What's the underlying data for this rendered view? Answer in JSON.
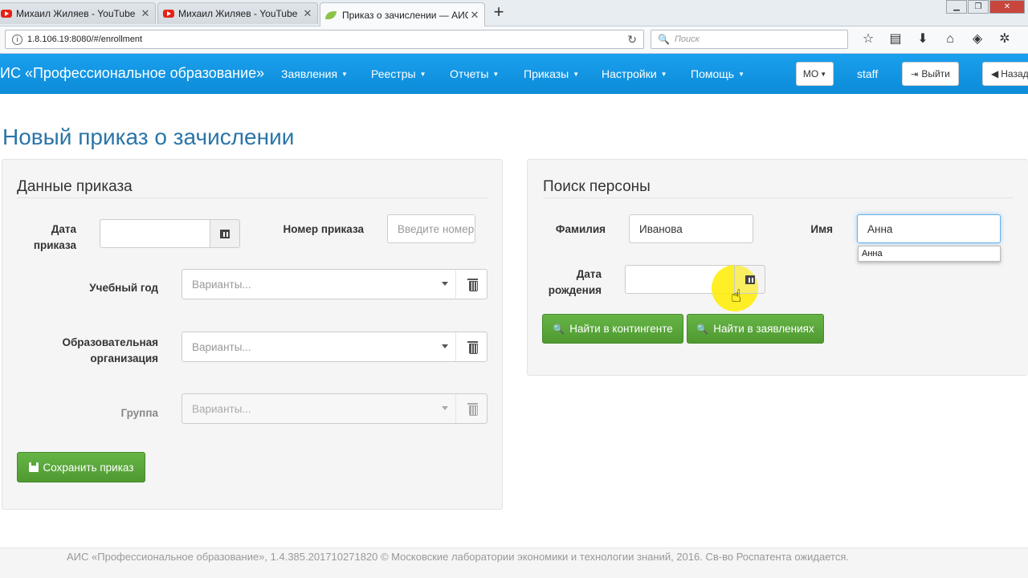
{
  "browser": {
    "tabs": [
      {
        "title": "Михаил Жиляев - YouTube"
      },
      {
        "title": "Михаил Жиляев - YouTube"
      },
      {
        "title": "Приказ о зачислении — АИС «Профессиональное образование»"
      }
    ],
    "url": "1.8.106.19:8080/#/enrollment",
    "search_placeholder": "Поиск"
  },
  "navbar": {
    "brand": "ИС «Профессиональное образование»",
    "menu": [
      "Заявления",
      "Реестры",
      "Отчеты",
      "Приказы",
      "Настройки",
      "Помощь"
    ],
    "region": "МО",
    "user": "staff",
    "logout": "Выйти",
    "back": "Назад"
  },
  "page": {
    "title": "Новый приказ о зачислении"
  },
  "order_panel": {
    "legend": "Данные приказа",
    "date_label": "Дата приказа",
    "date_value": "",
    "number_label": "Номер приказа",
    "number_placeholder": "Введите номер",
    "year_label": "Учебный год",
    "year_placeholder": "Варианты...",
    "org_label": "Образовательная организация",
    "org_placeholder": "Варианты...",
    "group_label": "Группа",
    "group_placeholder": "Варианты...",
    "save_button": "Сохранить приказ"
  },
  "search_panel": {
    "legend": "Поиск персоны",
    "lastname_label": "Фамилия",
    "lastname_value": "Иванова",
    "firstname_label": "Имя",
    "firstname_value": "Анна",
    "autocomplete_option": "Анна",
    "birthdate_label": "Дата рождения",
    "birthdate_value": "",
    "find_contingent_button": "Найти в контингенте",
    "find_applications_button": "Найти в заявлениях"
  },
  "footer": {
    "text": "АИС «Профессиональное образование», 1.4.385.201710271820 © Московские лаборатории экономики и технологии знаний, 2016. Св-во Роспатента ожидается."
  },
  "colors": {
    "navbar": "#0c8bd8",
    "title": "#2a75a8",
    "success": "#5cb03a"
  }
}
